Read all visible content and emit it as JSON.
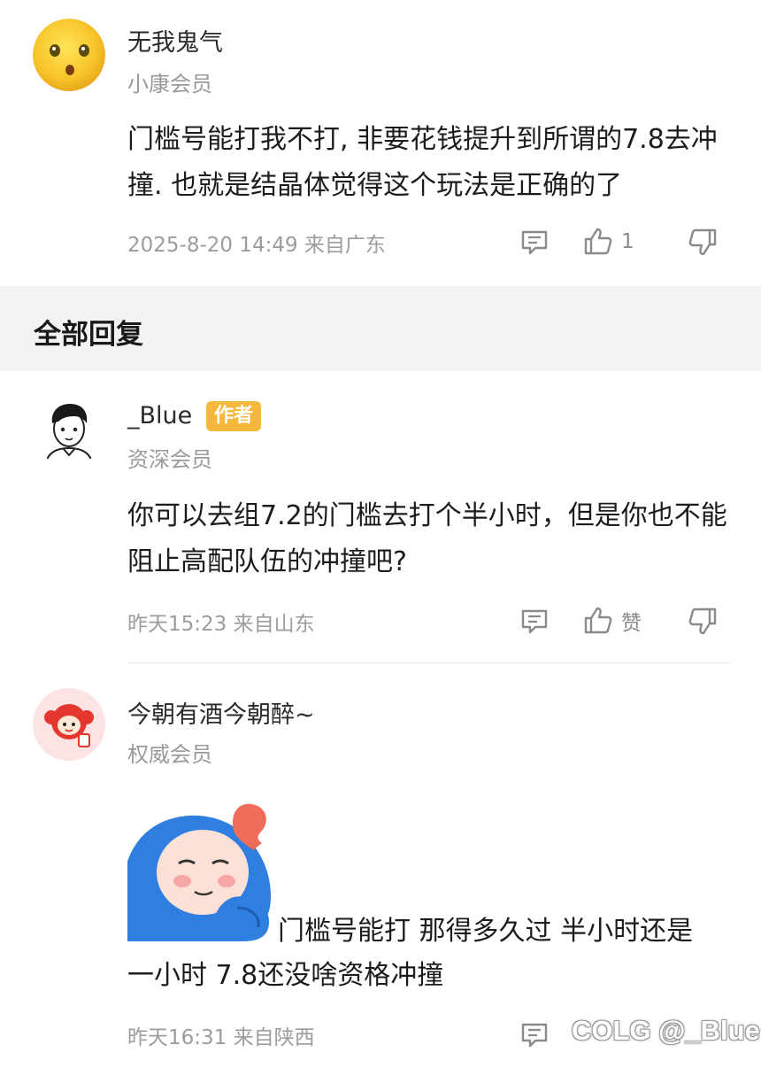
{
  "top_comment": {
    "username": "无我鬼气",
    "rank": "小康会员",
    "content": "门槛号能打我不打, 非要花钱提升到所谓的7.8去冲撞. 也就是结晶体觉得这个玩法是正确的了",
    "meta": "2025-8-20 14:49  来自广东",
    "like_count": "1",
    "avatar_icon": "yellow-face-avatar"
  },
  "section": {
    "title": "全部回复"
  },
  "replies": [
    {
      "username": "_Blue",
      "badge": "作者",
      "rank": "资深会员",
      "content": "你可以去组7.2的门槛去打个半小时，但是你也不能阻止高配队伍的冲撞吧?",
      "meta": "昨天15:23 来自山东",
      "like_label": "赞",
      "avatar_icon": "cartoon-man-avatar"
    },
    {
      "username": "今朝有酒今朝醉~",
      "rank": "权威会员",
      "content_line1": "门槛号能打 那得多久过 半小时还是",
      "content_line2": "一小时 7.8还没啥资格冲撞",
      "meta": "昨天16:31 来自陕西",
      "avatar_icon": "red-cartoon-avatar",
      "sticker_icon": "blue-hood-sticker"
    }
  ],
  "watermark": "COLG @_Blue",
  "colors": {
    "badge": "#f6b83c",
    "section_band": "#f3f3f3",
    "meta_text": "#9c9c9c"
  }
}
